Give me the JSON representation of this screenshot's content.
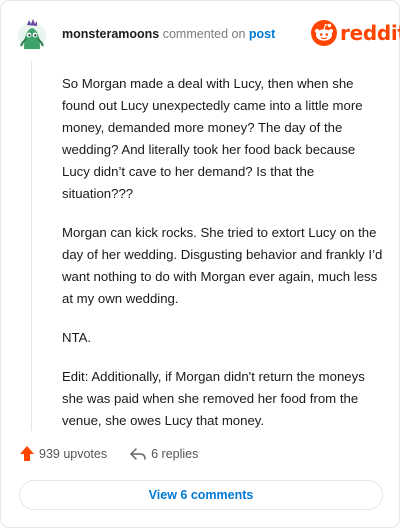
{
  "header": {
    "username": "monsteramoons",
    "action": "commented on",
    "target": "post",
    "brand": "reddit"
  },
  "comment": {
    "paragraphs": [
      "So Morgan made a deal with Lucy, then when she found out Lucy unexpectedly came into a little more money, demanded more money? The day of the wedding? And literally took her food back because Lucy didn’t cave to her demand? Is that the situation???",
      "Morgan can kick rocks. She tried to extort Lucy on the day of her wedding. Disgusting behavior and frankly I’d want nothing to do with Morgan ever again, much less at my own wedding.",
      "NTA.",
      "Edit: Additionally, if Morgan didn't return the moneys she was paid when she removed her food from the venue, she owes Lucy that money."
    ]
  },
  "stats": {
    "upvotes": "939 upvotes",
    "replies": "6 replies"
  },
  "footer": {
    "view_comments": "View 6 comments"
  },
  "colors": {
    "brand": "#ff4500",
    "link": "#0079d3",
    "avatar": "#3fa36c"
  },
  "icons": {
    "avatar": "monster-avatar-icon",
    "logo": "reddit-snoo-icon",
    "upvote": "upvote-arrow-icon",
    "reply": "reply-arrow-icon"
  }
}
